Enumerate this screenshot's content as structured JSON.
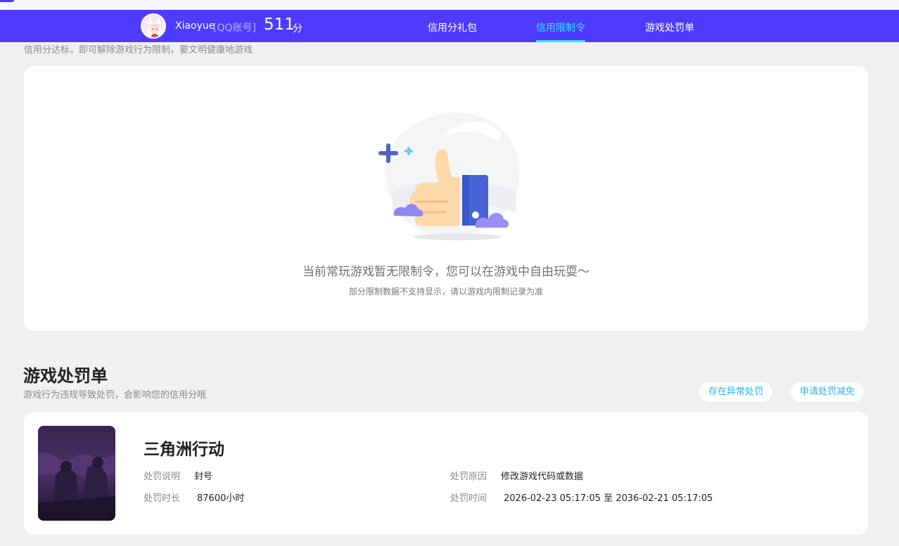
{
  "header": {
    "username": "Xiaoyue",
    "account_type": "[QQ账号]",
    "score": "511",
    "score_unit": "分",
    "tabs": [
      {
        "label": "信用分礼包",
        "active": false
      },
      {
        "label": "信用限制令",
        "active": true
      },
      {
        "label": "游戏处罚单",
        "active": false
      }
    ],
    "active_color": "#35e0ff",
    "bg_color": "#4e3bff"
  },
  "restriction": {
    "subtitle": "信用分达标，即可解除游戏行为限制，要文明健康地游戏",
    "empty_title": "当前常玩游戏暂无限制令，您可以在游戏中自由玩耍～",
    "empty_note": "部分限制数据不支持显示，请以游戏内限制记录为准"
  },
  "penalty_section": {
    "title": "游戏处罚单",
    "subtitle": "游戏行为违规导致处罚，会影响您的信用分哦",
    "buttons": {
      "abnormal": "存在异常处罚",
      "reduce": "申请处罚减免"
    },
    "record": {
      "game_name": "三角洲行动",
      "desc_label": "处罚说明",
      "desc_value": "封号",
      "reason_label": "处罚原因",
      "reason_value": "修改游戏代码或数据",
      "duration_label": "处罚时长",
      "duration_value": "87600小时",
      "time_label": "处罚时间",
      "time_value": "2026-02-23 05:17:05 至 2036-02-21 05:17:05"
    }
  }
}
